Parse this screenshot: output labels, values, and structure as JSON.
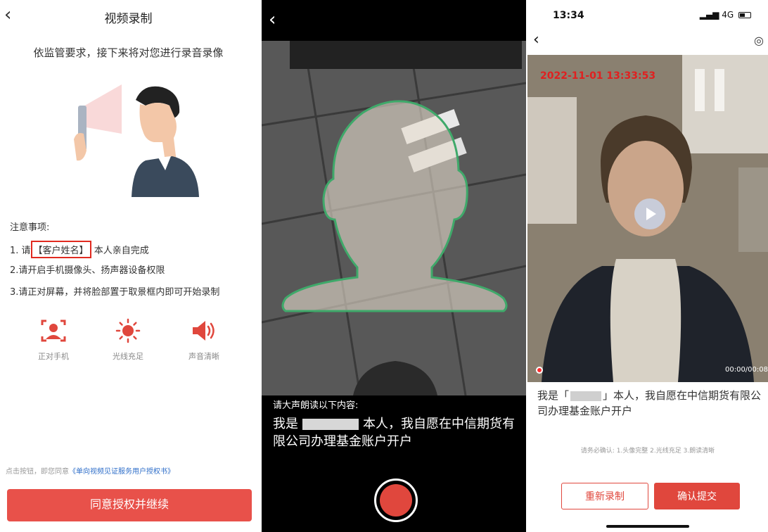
{
  "colors": {
    "accent": "#e0473d",
    "link": "#2e6ec9",
    "highlight": "#e02a20"
  },
  "panel1": {
    "back_icon": "chevron-left-icon",
    "title": "视频录制",
    "subtitle": "依监管要求，接下来将对您进行录音录像",
    "notes": {
      "heading": "注意事项:",
      "item1_prefix": "1. 请",
      "item1_name": "【客户姓名】",
      "item1_suffix": "本人亲自完成",
      "item2": "2.请开启手机摄像头、扬声器设备权限",
      "item3": "3.请正对屏幕，并将脸部置于取景框内即可开始录制"
    },
    "features": [
      {
        "icon": "face-frame-icon",
        "label": "正对手机"
      },
      {
        "icon": "sun-icon",
        "label": "光线充足"
      },
      {
        "icon": "speaker-icon",
        "label": "声音清晰"
      }
    ],
    "consent_prefix": "点击按钮，即您同意",
    "consent_link": "《单向视频见证服务用户授权书》",
    "agree_button": "同意授权并继续"
  },
  "panel2": {
    "back_icon": "chevron-left-icon",
    "read_label": "请大声朗读以下内容:",
    "read_text_prefix": "我是",
    "read_text_suffix": "本人，我自愿在中信期货有限公司办理基金账户开户"
  },
  "panel3": {
    "status_time": "13:34",
    "network": "4G",
    "video_timestamp": "2022-11-01 13:33:53",
    "duration": "00:00/00:08",
    "read_text_prefix": "我是「",
    "read_text_suffix": "」本人，我自愿在中信期货有限公司办理基金账户开户",
    "confirm_note": "请务必确认: 1.头像完整 2.光线充足 3.朗读清晰",
    "rerecord_button": "重新录制",
    "submit_button": "确认提交"
  }
}
